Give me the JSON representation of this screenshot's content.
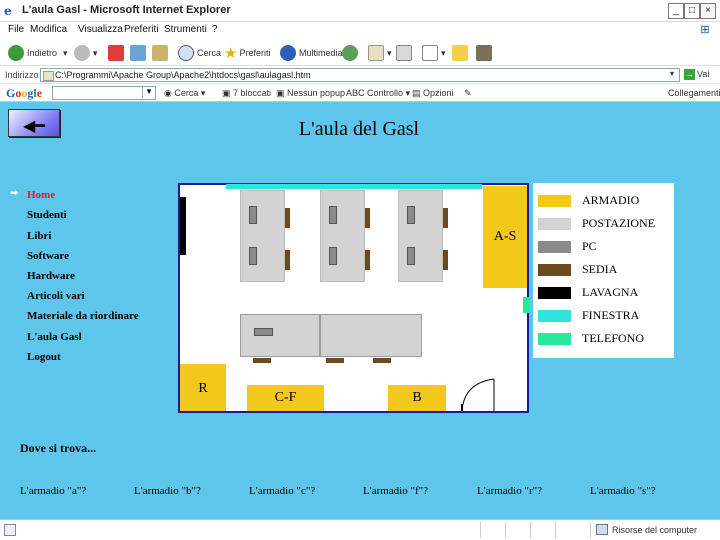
{
  "window": {
    "title": "L'aula Gasl - Microsoft Internet Explorer",
    "minimize": "_",
    "maximize": "□",
    "close": "×",
    "app_icon": "ie-logo-icon"
  },
  "menu": [
    "File",
    "Modifica",
    "Visualizza",
    "Preferiti",
    "Strumenti",
    "?"
  ],
  "toolbar": {
    "back": "Indietro",
    "search": "Cerca",
    "favorites": "Preferiti",
    "multimedia": "Multimedia"
  },
  "address": {
    "label": "Indirizzo",
    "value": "C:\\Programmi\\Apache Group\\Apache2\\htdocs\\gasl\\aulagasl.htm",
    "go": "Vai"
  },
  "google": {
    "logo": "Google",
    "search_btn": "Cerca",
    "blocked_label": "7 bloccati",
    "spell": "Controllo",
    "options": "Opzioni",
    "links_label": "Collegamenti"
  },
  "page": {
    "title": "L'aula del Gasl",
    "back_icon": "back-arrow-icon",
    "nav": [
      {
        "label": "Home",
        "active": true
      },
      {
        "label": "Studenti",
        "active": false
      },
      {
        "label": "Libri",
        "active": false
      },
      {
        "label": "Software",
        "active": false
      },
      {
        "label": "Hardware",
        "active": false
      },
      {
        "label": "Articoli vari",
        "active": false
      },
      {
        "label": "Materiale da riordinare",
        "active": false
      },
      {
        "label": "L'aula Gasl",
        "active": false
      },
      {
        "label": "Logout",
        "active": false
      }
    ],
    "plan_labels": {
      "as": "A-S",
      "r": "R",
      "cf": "C-F",
      "b": "B"
    },
    "legend": [
      {
        "name": "ARMADIO",
        "color": "#f2c81a"
      },
      {
        "name": "POSTAZIONE",
        "color": "#d3d3d3"
      },
      {
        "name": "PC",
        "color": "#8a8a8a"
      },
      {
        "name": "SEDIA",
        "color": "#6b4a1e"
      },
      {
        "name": "LAVAGNA",
        "color": "#000000"
      },
      {
        "name": "FINESTRA",
        "color": "#2fe3e0"
      },
      {
        "name": "TELEFONO",
        "color": "#25e89a"
      }
    ],
    "where_heading": "Dove si trova...",
    "questions": [
      "L'armadio \"a\"?",
      "L'armadio \"b\"?",
      "L'armadio \"c\"?",
      "L'armadio \"f\"?",
      "L'armadio \"r\"?",
      "L'armadio \"s\"?"
    ]
  },
  "status": {
    "zone": "Risorse del computer"
  }
}
